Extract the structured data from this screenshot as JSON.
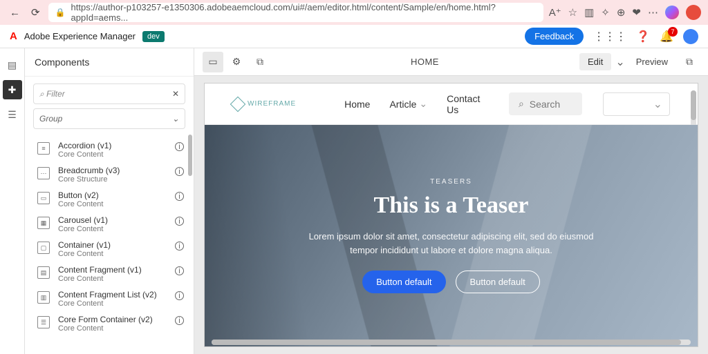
{
  "browser": {
    "url": "https://author-p103257-e1350306.adobeaemcloud.com/ui#/aem/editor.html/content/Sample/en/home.html?appId=aems..."
  },
  "aem": {
    "product": "Adobe Experience Manager",
    "env_badge": "dev",
    "feedback": "Feedback",
    "notifications": "7"
  },
  "panel": {
    "title": "Components",
    "filter_placeholder": "Filter",
    "group_label": "Group",
    "items": [
      {
        "name": "Accordion (v1)",
        "group": "Core Content"
      },
      {
        "name": "Breadcrumb (v3)",
        "group": "Core Structure"
      },
      {
        "name": "Button (v2)",
        "group": "Core Content"
      },
      {
        "name": "Carousel (v1)",
        "group": "Core Content"
      },
      {
        "name": "Container (v1)",
        "group": "Core Content"
      },
      {
        "name": "Content Fragment (v1)",
        "group": "Core Content"
      },
      {
        "name": "Content Fragment List (v2)",
        "group": "Core Content"
      },
      {
        "name": "Core Form Container (v2)",
        "group": "Core Content"
      }
    ]
  },
  "toolbar": {
    "page_title": "HOME",
    "mode": "Edit",
    "preview": "Preview"
  },
  "page": {
    "brand": "WIREFRAME",
    "nav": {
      "home": "Home",
      "article": "Article",
      "contact": "Contact Us"
    },
    "search_placeholder": "Search",
    "hero": {
      "eyebrow": "TEASERS",
      "title": "This is a Teaser",
      "body": "Lorem ipsum dolor sit amet, consectetur adipiscing elit, sed do eiusmod tempor incididunt ut labore et dolore magna aliqua.",
      "btn_primary": "Button default",
      "btn_secondary": "Button default"
    }
  }
}
